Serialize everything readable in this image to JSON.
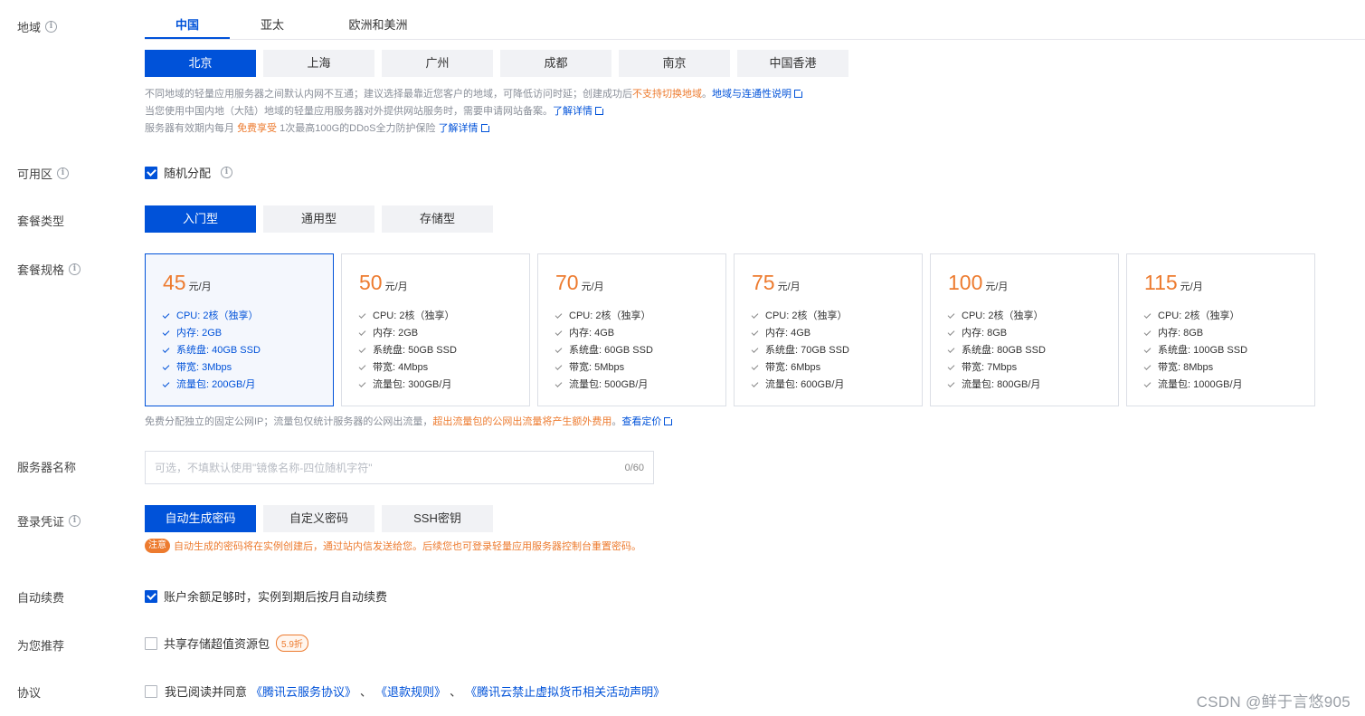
{
  "labels": {
    "region": "地域",
    "zone": "可用区",
    "plan_type": "套餐类型",
    "plan_spec": "套餐规格",
    "server_name": "服务器名称",
    "credential": "登录凭证",
    "auto_renew": "自动续费",
    "recommend": "为您推荐",
    "agreement": "协议"
  },
  "region_tabs": [
    {
      "label": "中国",
      "active": true
    },
    {
      "label": "亚太",
      "active": false
    },
    {
      "label": "欧洲和美洲",
      "active": false
    }
  ],
  "cities": [
    {
      "label": "北京",
      "active": true
    },
    {
      "label": "上海",
      "active": false
    },
    {
      "label": "广州",
      "active": false
    },
    {
      "label": "成都",
      "active": false
    },
    {
      "label": "南京",
      "active": false
    },
    {
      "label": "中国香港",
      "active": false
    }
  ],
  "region_notes": {
    "line1_text": "不同地域的轻量应用服务器之间默认内网不互通；建议选择最靠近您客户的地域，可降低访问时延；创建成功后",
    "line1_orange": "不支持切换地域",
    "line1_sep": "。",
    "line1_link": "地域与连通性说明",
    "line2_text": "当您使用中国内地（大陆）地域的轻量应用服务器对外提供网站服务时，需要申请网站备案。",
    "line2_link": "了解详情",
    "line3_text1": "服务器有效期内每月",
    "line3_orange": "免费享受",
    "line3_text2": "1次最高100G的DDoS全力防护保险",
    "line3_link": "了解详情"
  },
  "zone": {
    "label": "随机分配",
    "checked": true
  },
  "plan_types": [
    {
      "label": "入门型",
      "active": true
    },
    {
      "label": "通用型",
      "active": false
    },
    {
      "label": "存储型",
      "active": false
    }
  ],
  "price_unit": "元/月",
  "plans": [
    {
      "price": "45",
      "cpu": "CPU: 2核（独享）",
      "mem": "内存: 2GB",
      "disk": "系统盘: 40GB SSD",
      "bw": "带宽: 3Mbps",
      "traffic": "流量包: 200GB/月"
    },
    {
      "price": "50",
      "cpu": "CPU: 2核（独享）",
      "mem": "内存: 2GB",
      "disk": "系统盘: 50GB SSD",
      "bw": "带宽: 4Mbps",
      "traffic": "流量包: 300GB/月"
    },
    {
      "price": "70",
      "cpu": "CPU: 2核（独享）",
      "mem": "内存: 4GB",
      "disk": "系统盘: 60GB SSD",
      "bw": "带宽: 5Mbps",
      "traffic": "流量包: 500GB/月"
    },
    {
      "price": "75",
      "cpu": "CPU: 2核（独享）",
      "mem": "内存: 4GB",
      "disk": "系统盘: 70GB SSD",
      "bw": "带宽: 6Mbps",
      "traffic": "流量包: 600GB/月"
    },
    {
      "price": "100",
      "cpu": "CPU: 2核（独享）",
      "mem": "内存: 8GB",
      "disk": "系统盘: 80GB SSD",
      "bw": "带宽: 7Mbps",
      "traffic": "流量包: 800GB/月"
    },
    {
      "price": "115",
      "cpu": "CPU: 2核（独享）",
      "mem": "内存: 8GB",
      "disk": "系统盘: 100GB SSD",
      "bw": "带宽: 8Mbps",
      "traffic": "流量包: 1000GB/月"
    }
  ],
  "plan_note": {
    "text": "免费分配独立的固定公网IP；流量包仅统计服务器的公网出流量，",
    "orange": "超出流量包的公网出流量将产生额外费用",
    "sep": "。",
    "link": "查看定价"
  },
  "server_name": {
    "placeholder": "可选，不填默认使用\"镜像名称-四位随机字符\"",
    "counter": "0/60"
  },
  "credentials": [
    {
      "label": "自动生成密码",
      "active": true
    },
    {
      "label": "自定义密码",
      "active": false
    },
    {
      "label": "SSH密钥",
      "active": false
    }
  ],
  "credential_warning": {
    "badge": "注意",
    "text": "自动生成的密码将在实例创建后，通过站内信发送给您。后续您也可登录轻量应用服务器控制台重置密码。"
  },
  "auto_renew": {
    "label": "账户余额足够时，实例到期后按月自动续费",
    "checked": true
  },
  "recommend": {
    "label": "共享存储超值资源包",
    "badge": "5.9折",
    "checked": false
  },
  "agreement": {
    "prefix": "我已阅读并同意",
    "link1": "《腾讯云服务协议》",
    "sep1": "、",
    "link2": "《退款规则》",
    "sep2": "、",
    "link3": "《腾讯云禁止虚拟货币相关活动声明》",
    "checked": false
  },
  "watermark": "CSDN @鲜于言悠905",
  "colors": {
    "primary": "#0052d9",
    "orange": "#ed7b2f"
  }
}
